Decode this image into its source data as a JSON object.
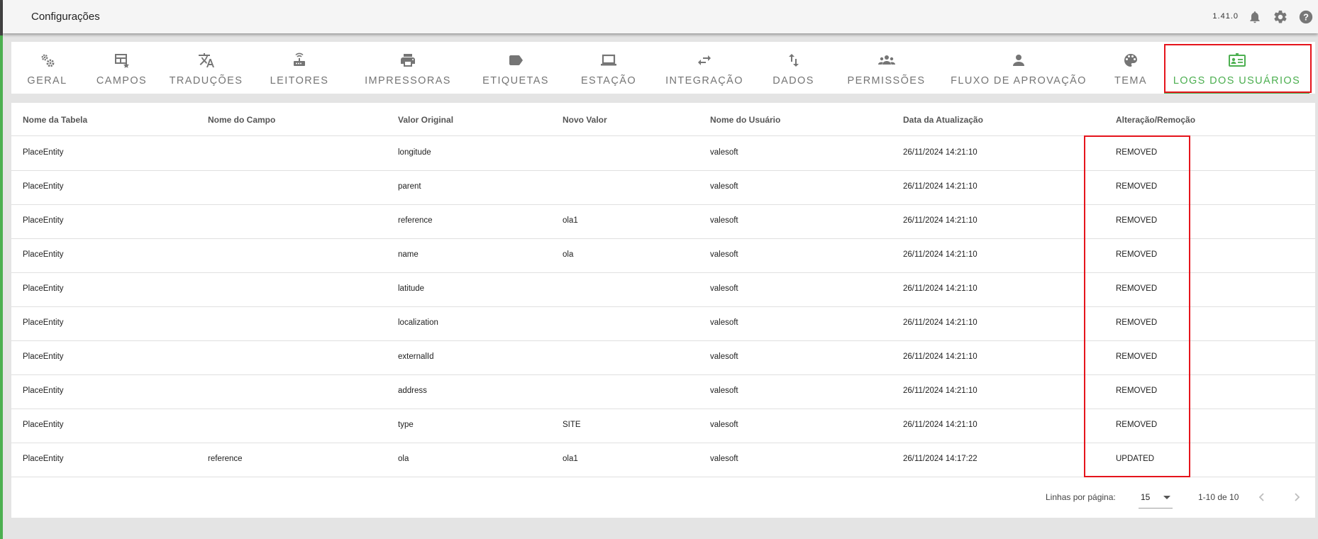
{
  "header": {
    "title": "Configurações",
    "version": "1.41.0"
  },
  "tabs": [
    {
      "label": "GERAL",
      "icon": "gears-icon",
      "active": false
    },
    {
      "label": "CAMPOS",
      "icon": "table-edit-icon",
      "active": false
    },
    {
      "label": "TRADUÇÕES",
      "icon": "translate-icon",
      "active": false
    },
    {
      "label": "LEITORES",
      "icon": "router-icon",
      "active": false
    },
    {
      "label": "IMPRESSORAS",
      "icon": "printer-icon",
      "active": false
    },
    {
      "label": "ETIQUETAS",
      "icon": "label-icon",
      "active": false
    },
    {
      "label": "ESTAÇÃO",
      "icon": "laptop-icon",
      "active": false
    },
    {
      "label": "INTEGRAÇÃO",
      "icon": "swap-arrows-icon",
      "active": false
    },
    {
      "label": "DADOS",
      "icon": "swap-vertical-icon",
      "active": false
    },
    {
      "label": "PERMISSÕES",
      "icon": "group-icon",
      "active": false
    },
    {
      "label": "FLUXO DE APROVAÇÃO",
      "icon": "person-icon",
      "active": false
    },
    {
      "label": "TEMA",
      "icon": "palette-icon",
      "active": false
    },
    {
      "label": "LOGS DOS USUÁRIOS",
      "icon": "user-card-icon",
      "active": true
    }
  ],
  "table": {
    "columns": [
      "Nome da Tabela",
      "Nome do Campo",
      "Valor Original",
      "Novo Valor",
      "Nome do Usuário",
      "Data da Atualização",
      "Alteração/Remoção"
    ],
    "rows": [
      [
        "PlaceEntity",
        "",
        "longitude",
        "",
        "valesoft",
        "26/11/2024 14:21:10",
        "REMOVED"
      ],
      [
        "PlaceEntity",
        "",
        "parent",
        "",
        "valesoft",
        "26/11/2024 14:21:10",
        "REMOVED"
      ],
      [
        "PlaceEntity",
        "",
        "reference",
        "ola1",
        "valesoft",
        "26/11/2024 14:21:10",
        "REMOVED"
      ],
      [
        "PlaceEntity",
        "",
        "name",
        "ola",
        "valesoft",
        "26/11/2024 14:21:10",
        "REMOVED"
      ],
      [
        "PlaceEntity",
        "",
        "latitude",
        "",
        "valesoft",
        "26/11/2024 14:21:10",
        "REMOVED"
      ],
      [
        "PlaceEntity",
        "",
        "localization",
        "",
        "valesoft",
        "26/11/2024 14:21:10",
        "REMOVED"
      ],
      [
        "PlaceEntity",
        "",
        "externalId",
        "",
        "valesoft",
        "26/11/2024 14:21:10",
        "REMOVED"
      ],
      [
        "PlaceEntity",
        "",
        "address",
        "",
        "valesoft",
        "26/11/2024 14:21:10",
        "REMOVED"
      ],
      [
        "PlaceEntity",
        "",
        "type",
        "SITE",
        "valesoft",
        "26/11/2024 14:21:10",
        "REMOVED"
      ],
      [
        "PlaceEntity",
        "reference",
        "ola",
        "ola1",
        "valesoft",
        "26/11/2024 14:17:22",
        "UPDATED"
      ]
    ]
  },
  "pagination": {
    "rows_per_page_label": "Linhas por página:",
    "rows_per_page_value": "15",
    "range_text": "1-10 de 10"
  },
  "colors": {
    "accent": "#4caf50",
    "highlight_box": "#e5141c",
    "icon_gray": "#757575"
  }
}
